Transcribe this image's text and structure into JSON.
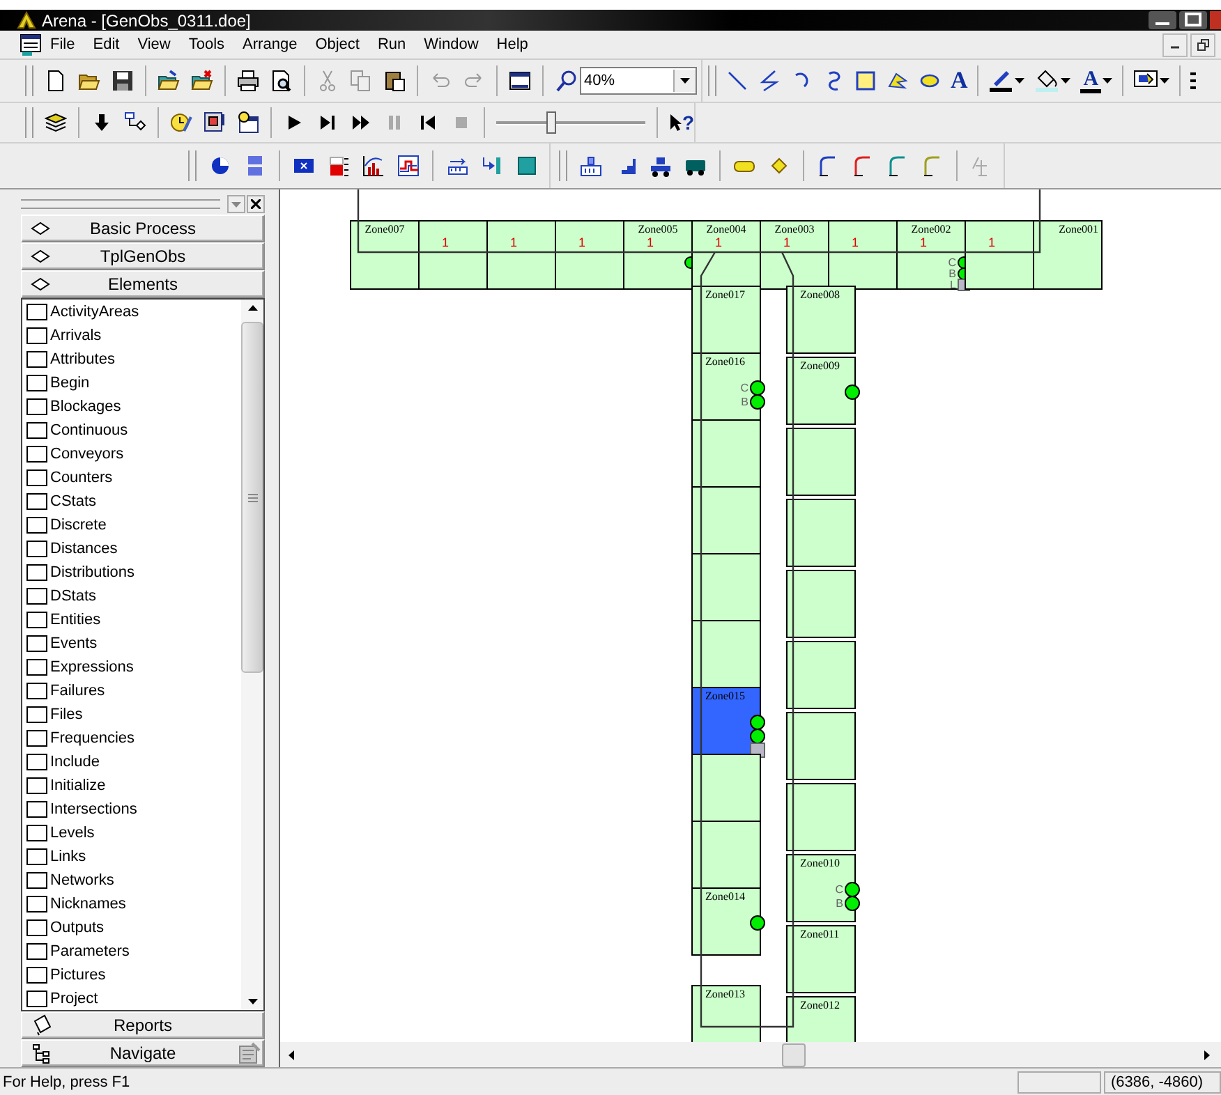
{
  "window": {
    "title": "Arena - [GenObs_0311.doe]"
  },
  "menu": [
    "File",
    "Edit",
    "View",
    "Tools",
    "Arrange",
    "Object",
    "Run",
    "Window",
    "Help"
  ],
  "toolbar": {
    "zoom": "40%",
    "text_tool": "A",
    "font_color": "A",
    "help": "?",
    "speed_slider": {
      "level": 0.35
    }
  },
  "project_bar": {
    "panels": [
      {
        "label": "Basic Process",
        "kind": "template"
      },
      {
        "label": "TplGenObs",
        "kind": "template"
      },
      {
        "label": "Elements",
        "kind": "template"
      }
    ],
    "elements": [
      "ActivityAreas",
      "Arrivals",
      "Attributes",
      "Begin",
      "Blockages",
      "Continuous",
      "Conveyors",
      "Counters",
      "CStats",
      "Discrete",
      "Distances",
      "Distributions",
      "DStats",
      "Entities",
      "Events",
      "Expressions",
      "Failures",
      "Files",
      "Frequencies",
      "Include",
      "Initialize",
      "Intersections",
      "Levels",
      "Links",
      "Networks",
      "Nicknames",
      "Outputs",
      "Parameters",
      "Pictures",
      "Project"
    ],
    "footer_panels": [
      {
        "label": "Reports",
        "kind": "reports"
      },
      {
        "label": "Navigate",
        "kind": "navigate"
      }
    ]
  },
  "canvas": {
    "top_row": [
      {
        "label": "Zone007",
        "highlighted": false
      },
      {
        "count": "1",
        "highlighted": false
      },
      {
        "count": "1",
        "highlighted": false
      },
      {
        "count": "1",
        "highlighted": false
      },
      {
        "label": "Zone005",
        "count": "1",
        "highlighted": false,
        "signals": [
          {
            "kind": "dot"
          }
        ]
      },
      {
        "label": "Zone004",
        "count": "1",
        "highlighted": false
      },
      {
        "label": "Zone003",
        "count": "1",
        "highlighted": false
      },
      {
        "count": "1",
        "highlighted": false
      },
      {
        "label": "Zone002",
        "count": "1",
        "highlighted": false,
        "signals": [
          {
            "kind": "dot",
            "letter": "C"
          },
          {
            "kind": "dot",
            "letter": "B"
          },
          {
            "kind": "square",
            "letter": "L"
          }
        ]
      },
      {
        "count": "1",
        "highlighted": false
      },
      {
        "label": "Zone001",
        "highlighted": false
      }
    ],
    "left_column": [
      {
        "label": "Zone017",
        "highlighted": false
      },
      {
        "label": "Zone016",
        "highlighted": false,
        "signals": [
          {
            "kind": "dot",
            "letter": "C"
          },
          {
            "kind": "dot",
            "letter": "B"
          }
        ]
      },
      {
        "highlighted": false
      },
      {
        "highlighted": false
      },
      {
        "highlighted": false
      },
      {
        "highlighted": false
      },
      {
        "label": "Zone015",
        "highlighted": true,
        "signals": [
          {
            "kind": "dot"
          },
          {
            "kind": "dot"
          },
          {
            "kind": "square"
          }
        ]
      },
      {
        "highlighted": false
      },
      {
        "highlighted": false
      },
      {
        "label": "Zone014",
        "highlighted": false,
        "signals": [
          {
            "kind": "dot"
          }
        ]
      },
      {
        "label": "Zone013",
        "highlighted": false
      }
    ],
    "right_column": [
      {
        "label": "Zone008",
        "highlighted": false
      },
      {
        "label": "Zone009",
        "highlighted": false,
        "signals": [
          {
            "kind": "dot"
          }
        ]
      },
      {
        "highlighted": false
      },
      {
        "highlighted": false
      },
      {
        "highlighted": false
      },
      {
        "highlighted": false
      },
      {
        "highlighted": false
      },
      {
        "highlighted": false
      },
      {
        "label": "Zone010",
        "highlighted": false,
        "signals": [
          {
            "kind": "dot",
            "letter": "C"
          },
          {
            "kind": "dot",
            "letter": "B"
          }
        ]
      },
      {
        "label": "Zone011",
        "highlighted": false
      },
      {
        "label": "Zone012",
        "highlighted": false
      }
    ]
  },
  "status_bar": {
    "help": "For Help, press F1",
    "coordinates": "(6386, -4860)"
  }
}
